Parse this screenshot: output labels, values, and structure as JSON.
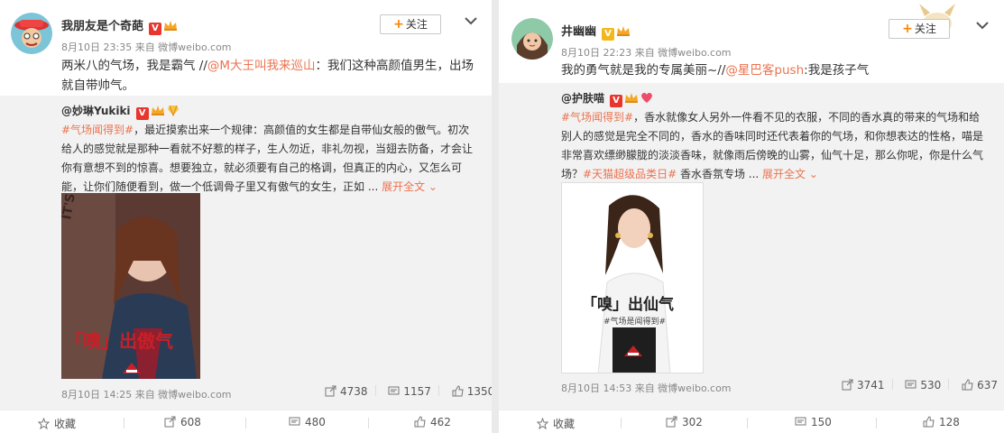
{
  "colors": {
    "accent": "#eb7350",
    "follow_plus": "#ff8200",
    "verified_red": "#e8352e",
    "verified_gold": "#f4b71b",
    "repost_bg": "#f2f2f2"
  },
  "left_post": {
    "author": "我朋友是个奇葩",
    "badges": [
      "verified-v-icon",
      "crown-icon"
    ],
    "meta": "8月10日 23:35 来自 微博weibo.com",
    "follow_label": "关注",
    "text_prefix": "两米八的气场，我是霸气 //",
    "text_mention": "@M大王叫我来巡山",
    "text_suffix": "：我们这种高颜值男生，出场就自带帅气。",
    "repost": {
      "author": "@妙琳Yukiki",
      "badges": [
        "verified-v-icon",
        "crown-icon",
        "diamond-heart-icon"
      ],
      "hashtag": "#气场闻得到#",
      "text": "，最近摸索出来一个规律：高颜值的女生都是自带仙女般的傲气。初次给人的感觉就是那种一看就不好惹的样子，生人勿近，非礼勿视，当翅去防备，才会让你有意想不到的惊喜。想要独立，就必须要有自己的格调，但真正的内心，又怎么可能，让你们随便看到，做一个低调骨子里又有傲气的女生，正如 ...",
      "expand_label": "展开全文",
      "image_caption": "「嗅」出傲气",
      "image_side_text": "IT'S MORE THAN",
      "footer_meta": "8月10日 14:25 来自 微博weibo.com",
      "stats": {
        "repost": "4738",
        "comment": "1157",
        "like": "1350"
      }
    },
    "actions": {
      "favorite": "收藏",
      "repost": "608",
      "comment": "480",
      "like": "462"
    }
  },
  "right_post": {
    "author": "井幽幽",
    "badges": [
      "verified-v-gold-icon",
      "crown-icon"
    ],
    "meta": "8月10日 22:23 来自 微博weibo.com",
    "follow_label": "关注",
    "text_prefix": "我的勇气就是我的专属美丽~//",
    "text_mention": "@星巴客push",
    "text_suffix": ":我是孩子气",
    "repost": {
      "author": "@护肤喵",
      "badges": [
        "verified-v-icon",
        "crown-icon",
        "heart-icon"
      ],
      "hashtag": "#气场闻得到#",
      "text_before_tag2": "，香水就像女人另外一件看不见的衣服，不同的香水真的带来的气场和给别人的感觉是完全不同的，香水的香味同时还代表着你的气场，和你想表达的性格，喵是非常喜欢缥缈朦胧的淡淡香味，就像雨后傍晚的山雾，仙气十足，那么你呢，你是什么气场？",
      "hashtag2": "#天猫超级品类日#",
      "text_after_tag2": " 香水香氛专场 ...",
      "expand_label": "展开全文",
      "image_caption": "「嗅」出仙气",
      "image_subcaption": "#气场是闻得到#",
      "footer_meta": "8月10日 14:53 来自 微博weibo.com",
      "stats": {
        "repost": "3741",
        "comment": "530",
        "like": "637"
      }
    },
    "actions": {
      "favorite": "收藏",
      "repost": "302",
      "comment": "150",
      "like": "128"
    }
  }
}
